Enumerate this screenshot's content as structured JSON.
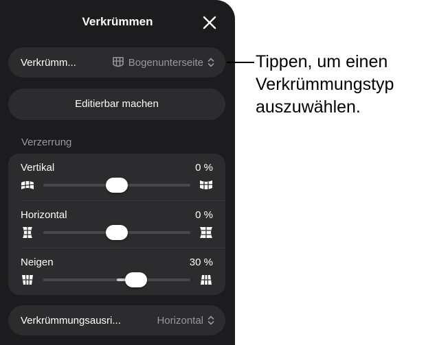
{
  "panel": {
    "title": "Verkrümmen",
    "close_icon": "close-icon"
  },
  "warp_type": {
    "label": "Verkrümm...",
    "icon": "arch-bottom-icon",
    "value": "Bogenunterseite",
    "chevron_icon": "chevron-up-down-icon"
  },
  "make_editable": {
    "label": "Editierbar machen"
  },
  "distortion": {
    "section_title": "Verzerrung",
    "sliders": [
      {
        "label": "Vertikal",
        "value_text": "0 %",
        "fraction": 0.5,
        "bipolar": true,
        "left_icon": "vertical-warp-minus-icon",
        "right_icon": "vertical-warp-plus-icon"
      },
      {
        "label": "Horizontal",
        "value_text": "0 %",
        "fraction": 0.5,
        "bipolar": true,
        "left_icon": "horizontal-warp-minus-icon",
        "right_icon": "horizontal-warp-plus-icon"
      },
      {
        "label": "Neigen",
        "value_text": "30 %",
        "fraction": 0.63,
        "bipolar": true,
        "left_icon": "bend-minus-icon",
        "right_icon": "bend-plus-icon"
      }
    ]
  },
  "warp_orientation": {
    "label": "Verkrümmungsausri...",
    "value": "Horizontal",
    "chevron_icon": "chevron-up-down-icon"
  },
  "callout": {
    "lines": [
      "Tippen, um einen",
      "Verkrümmungstyp",
      "auszuwählen."
    ]
  },
  "colors": {
    "panel_bg": "#1c1c1e",
    "row_bg": "#2c2c2e",
    "secondary_text": "#98989d",
    "text": "#ffffff"
  }
}
